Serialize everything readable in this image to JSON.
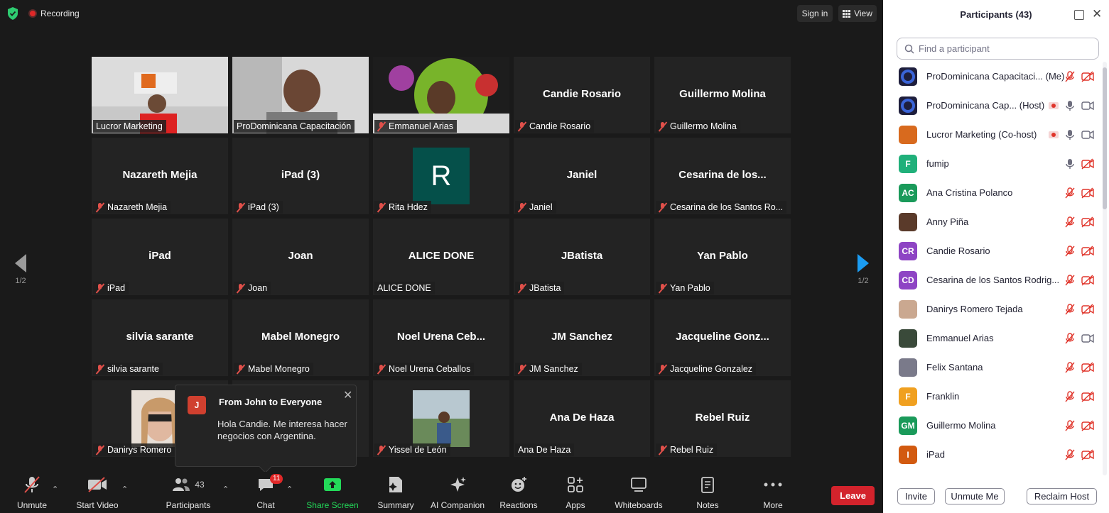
{
  "top": {
    "recording_label": "Recording",
    "signin_label": "Sign in",
    "view_label": "View"
  },
  "nav": {
    "left_page": "1/2",
    "right_page": "1/2"
  },
  "tiles": [
    {
      "name": "Lucror Marketing",
      "center": "",
      "video": true,
      "muted": false
    },
    {
      "name": "ProDominicana Capacitación",
      "center": "",
      "video": true,
      "muted": false,
      "active": true
    },
    {
      "name": "Emmanuel Arias",
      "center": "",
      "video": true,
      "muted": true
    },
    {
      "name": "Candie Rosario",
      "center": "Candie Rosario",
      "muted": true
    },
    {
      "name": "Guillermo Molina",
      "center": "Guillermo Molina",
      "muted": true
    },
    {
      "name": "Nazareth Mejia",
      "center": "Nazareth Mejia",
      "muted": true
    },
    {
      "name": "iPad (3)",
      "center": "iPad (3)",
      "muted": true
    },
    {
      "name": "Rita Hdez",
      "center": "",
      "avatar": "R",
      "muted": true
    },
    {
      "name": "Janiel",
      "center": "Janiel",
      "muted": true
    },
    {
      "name": "Cesarina de los Santos Ro...",
      "center": "Cesarina de los...",
      "muted": true
    },
    {
      "name": "iPad",
      "center": "iPad",
      "muted": true
    },
    {
      "name": "Joan",
      "center": "Joan",
      "muted": true
    },
    {
      "name": "ALICE DONE",
      "center": "ALICE DONE",
      "muted": false
    },
    {
      "name": "JBatista",
      "center": "JBatista",
      "muted": true
    },
    {
      "name": "Yan Pablo",
      "center": "Yan Pablo",
      "muted": true
    },
    {
      "name": "silvia sarante",
      "center": "silvia sarante",
      "muted": true
    },
    {
      "name": "Mabel Monegro",
      "center": "Mabel Monegro",
      "muted": true
    },
    {
      "name": "Noel Urena Ceballos",
      "center": "Noel Urena Ceb...",
      "muted": true
    },
    {
      "name": "JM Sanchez",
      "center": "JM Sanchez",
      "muted": true
    },
    {
      "name": "Jacqueline Gonzalez",
      "center": "Jacqueline Gonz...",
      "muted": true
    },
    {
      "name": "Danirys Romero",
      "center": "",
      "photo": true,
      "muted": true
    },
    {
      "name": "",
      "center": "",
      "muted": false
    },
    {
      "name": "Yissel de León",
      "center": "",
      "photo": true,
      "muted": true
    },
    {
      "name": "Ana De Haza",
      "center": "Ana De Haza",
      "muted": false
    },
    {
      "name": "Rebel Ruiz",
      "center": "Rebel Ruiz",
      "muted": true
    }
  ],
  "toast": {
    "avatar": "J",
    "title": "From John to Everyone",
    "message": "Hola Candie. Me interesa hacer negocios con Argentina."
  },
  "toolbar": {
    "unmute": "Unmute",
    "start_video": "Start Video",
    "participants": "Participants",
    "participants_count": "43",
    "chat": "Chat",
    "chat_badge": "11",
    "share_screen": "Share Screen",
    "summary": "Summary",
    "ai_companion": "AI Companion",
    "reactions": "Reactions",
    "apps": "Apps",
    "whiteboards": "Whiteboards",
    "notes": "Notes",
    "more": "More",
    "leave": "Leave"
  },
  "panel": {
    "title": "Participants (43)",
    "search_placeholder": "Find a participant",
    "invite": "Invite",
    "unmute_me": "Unmute Me",
    "reclaim_host": "Reclaim Host",
    "participants": [
      {
        "name": "ProDominicana Capacitaci... (Me)",
        "avatar": "",
        "color": "#1e1e3c",
        "mic": "off",
        "video": "off"
      },
      {
        "name": "ProDominicana Cap... (Host)",
        "avatar": "",
        "color": "#1e1e3c",
        "mic": "on",
        "video": "on",
        "rec": true
      },
      {
        "name": "Lucror Marketing (Co-host)",
        "avatar": "",
        "color": "#d86a1e",
        "mic": "on",
        "video": "on",
        "rec": true
      },
      {
        "name": "fumip",
        "avatar": "F",
        "color": "#20b07a",
        "mic": "on",
        "video": "off"
      },
      {
        "name": "Ana Cristina Polanco",
        "avatar": "AC",
        "color": "#1a9a5a",
        "mic": "off",
        "video": "off"
      },
      {
        "name": "Anny Piña",
        "avatar": "",
        "color": "#5a3a2a",
        "mic": "off",
        "video": "off"
      },
      {
        "name": "Candie Rosario",
        "avatar": "CR",
        "color": "#8e44c4",
        "mic": "off",
        "video": "off"
      },
      {
        "name": "Cesarina de los Santos Rodrig...",
        "avatar": "CD",
        "color": "#8e44c4",
        "mic": "off",
        "video": "off"
      },
      {
        "name": "Danirys Romero Tejada",
        "avatar": "",
        "color": "#caa890",
        "mic": "off",
        "video": "off"
      },
      {
        "name": "Emmanuel Arias",
        "avatar": "",
        "color": "#3a4a3a",
        "mic": "off",
        "video": "on"
      },
      {
        "name": "Felix Santana",
        "avatar": "",
        "color": "#7a7a8a",
        "mic": "off",
        "video": "off"
      },
      {
        "name": "Franklin",
        "avatar": "F",
        "color": "#f0a020",
        "mic": "off",
        "video": "off"
      },
      {
        "name": "Guillermo Molina",
        "avatar": "GM",
        "color": "#1a9a5a",
        "mic": "off",
        "video": "off"
      },
      {
        "name": "iPad",
        "avatar": "I",
        "color": "#d25a10",
        "mic": "off",
        "video": "off"
      }
    ]
  }
}
